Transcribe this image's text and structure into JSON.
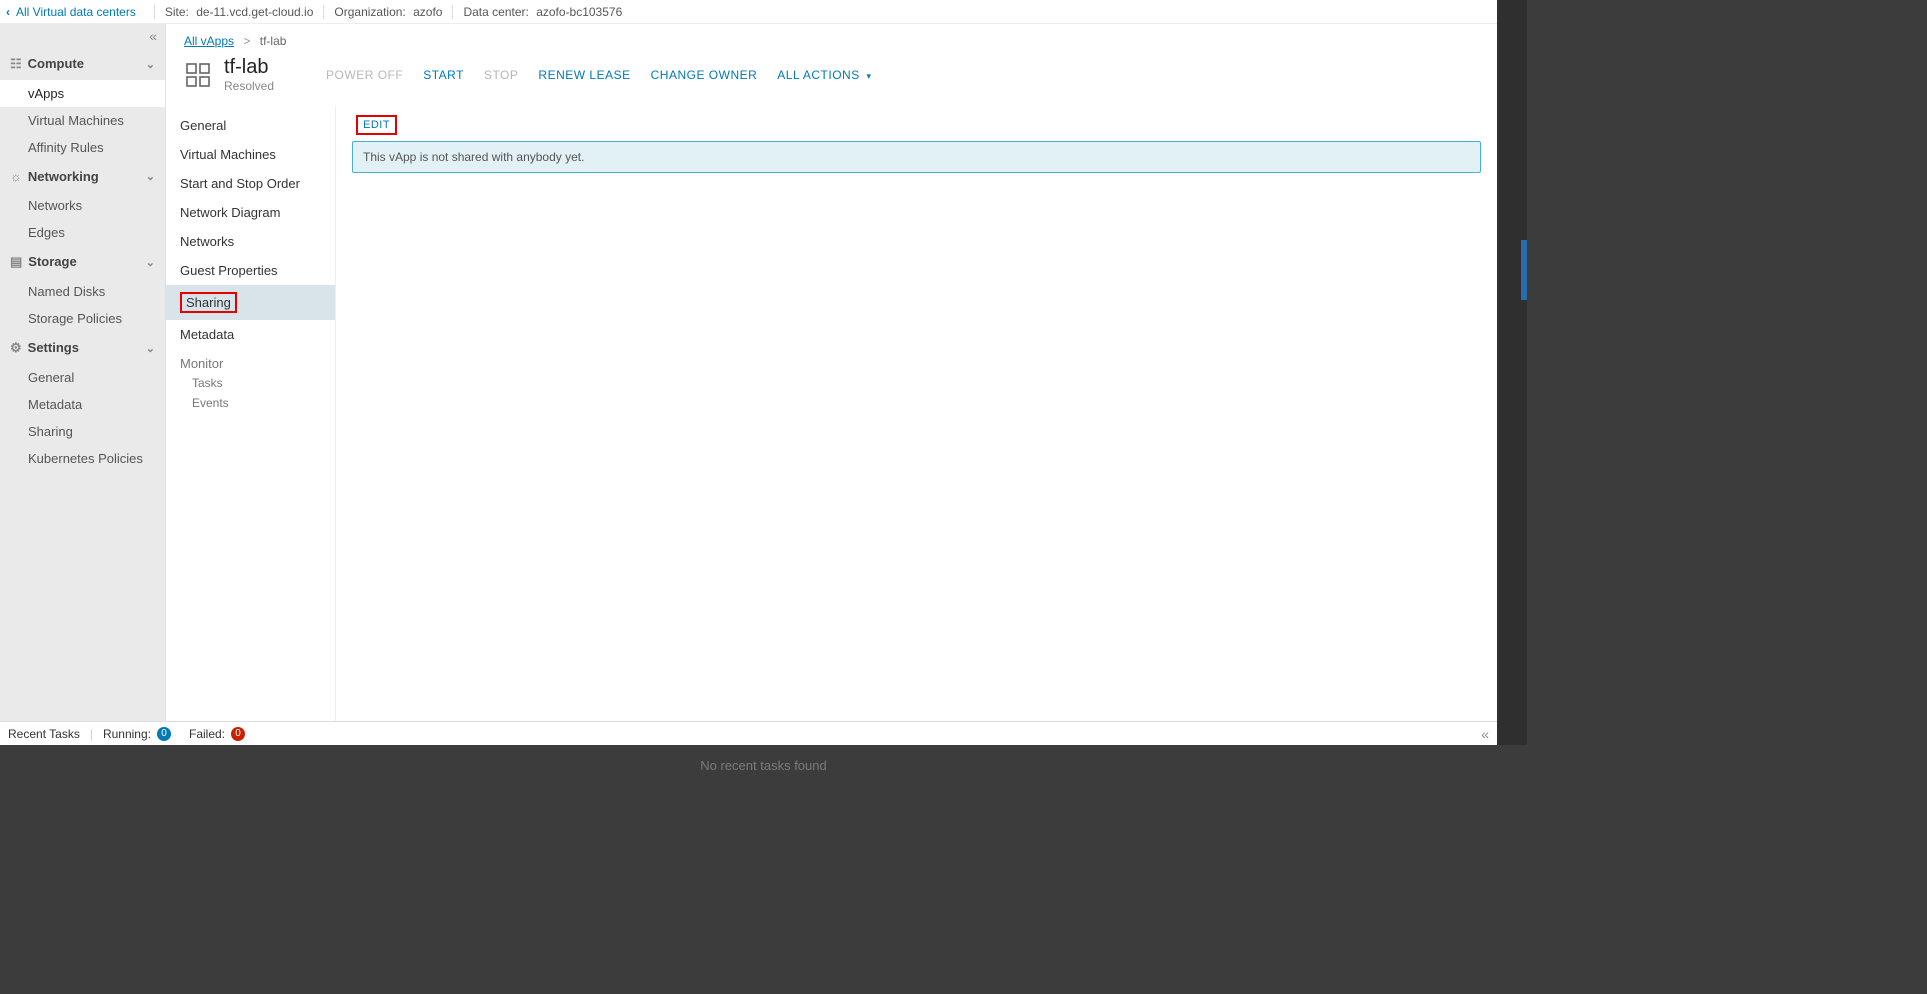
{
  "topbar": {
    "back_label": "All Virtual data centers",
    "site_label": "Site:",
    "site_value": "de-11.vcd.get-cloud.io",
    "org_label": "Organization:",
    "org_value": "azofo",
    "dc_label": "Data center:",
    "dc_value": "azofo-bc103576"
  },
  "sidebar": {
    "groups": [
      {
        "label": "Compute",
        "items": [
          {
            "label": "vApps",
            "active": true
          },
          {
            "label": "Virtual Machines"
          },
          {
            "label": "Affinity Rules"
          }
        ]
      },
      {
        "label": "Networking",
        "items": [
          {
            "label": "Networks"
          },
          {
            "label": "Edges"
          }
        ]
      },
      {
        "label": "Storage",
        "items": [
          {
            "label": "Named Disks"
          },
          {
            "label": "Storage Policies"
          }
        ]
      },
      {
        "label": "Settings",
        "items": [
          {
            "label": "General"
          },
          {
            "label": "Metadata"
          },
          {
            "label": "Sharing"
          },
          {
            "label": "Kubernetes Policies"
          }
        ]
      }
    ]
  },
  "breadcrumb": {
    "root": "All vApps",
    "current": "tf-lab"
  },
  "header": {
    "title": "tf-lab",
    "status": "Resolved",
    "actions": {
      "power_off": "POWER OFF",
      "start": "START",
      "stop": "STOP",
      "renew_lease": "RENEW LEASE",
      "change_owner": "CHANGE OWNER",
      "all_actions": "ALL ACTIONS"
    }
  },
  "subnav": {
    "items": [
      "General",
      "Virtual Machines",
      "Start and Stop Order",
      "Network Diagram",
      "Networks",
      "Guest Properties",
      "Sharing",
      "Metadata"
    ],
    "monitor_label": "Monitor",
    "monitor_items": [
      "Tasks",
      "Events"
    ]
  },
  "panel": {
    "edit_label": "EDIT",
    "info_text": "This vApp is not shared with anybody yet."
  },
  "recent": {
    "title": "Recent Tasks",
    "running_label": "Running:",
    "running_count": "0",
    "failed_label": "Failed:",
    "failed_count": "0"
  },
  "below_strip": "No recent tasks found"
}
